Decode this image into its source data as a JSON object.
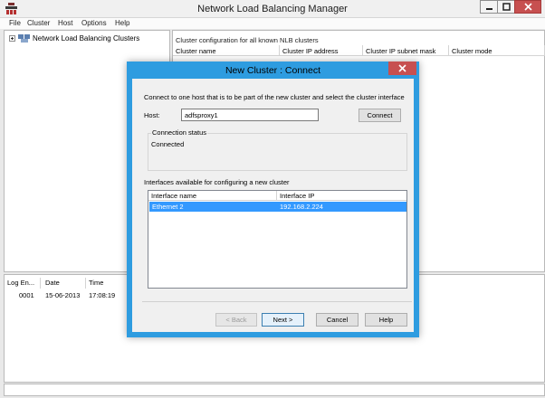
{
  "window": {
    "title": "Network Load Balancing Manager",
    "controls": {
      "minimize": "minimize-icon",
      "maximize": "maximize-icon",
      "close": "close-icon"
    }
  },
  "menu": {
    "items": [
      "File",
      "Cluster",
      "Host",
      "Options",
      "Help"
    ]
  },
  "tree": {
    "root_label": "Network Load Balancing Clusters"
  },
  "cluster_pane": {
    "caption": "Cluster configuration for all known NLB clusters",
    "columns": [
      "Cluster name",
      "Cluster IP address",
      "Cluster IP subnet mask",
      "Cluster mode"
    ]
  },
  "log": {
    "columns": [
      "Log En...",
      "Date",
      "Time"
    ],
    "rows": [
      {
        "entry": "0001",
        "date": "15-06-2013",
        "time": "17:08:19"
      }
    ]
  },
  "dialog": {
    "title": "New Cluster :  Connect",
    "instruction": "Connect to one host that is to be part of the new cluster and select the cluster interface",
    "host_label": "Host:",
    "host_value": "adfsproxy1",
    "connect_button": "Connect",
    "status_group_label": "Connection status",
    "status_value": "Connected",
    "interfaces_label": "Interfaces available for configuring a new cluster",
    "interface_columns": [
      "Interface name",
      "Interface IP"
    ],
    "interfaces": [
      {
        "name": "Ethernet 2",
        "ip": "192.168.2.224"
      }
    ],
    "buttons": {
      "back": "< Back",
      "next": "Next >",
      "cancel": "Cancel",
      "help": "Help"
    }
  },
  "colors": {
    "dialog_accent": "#2e9ce0",
    "close_button": "#c75050",
    "selection": "#3399ff"
  }
}
